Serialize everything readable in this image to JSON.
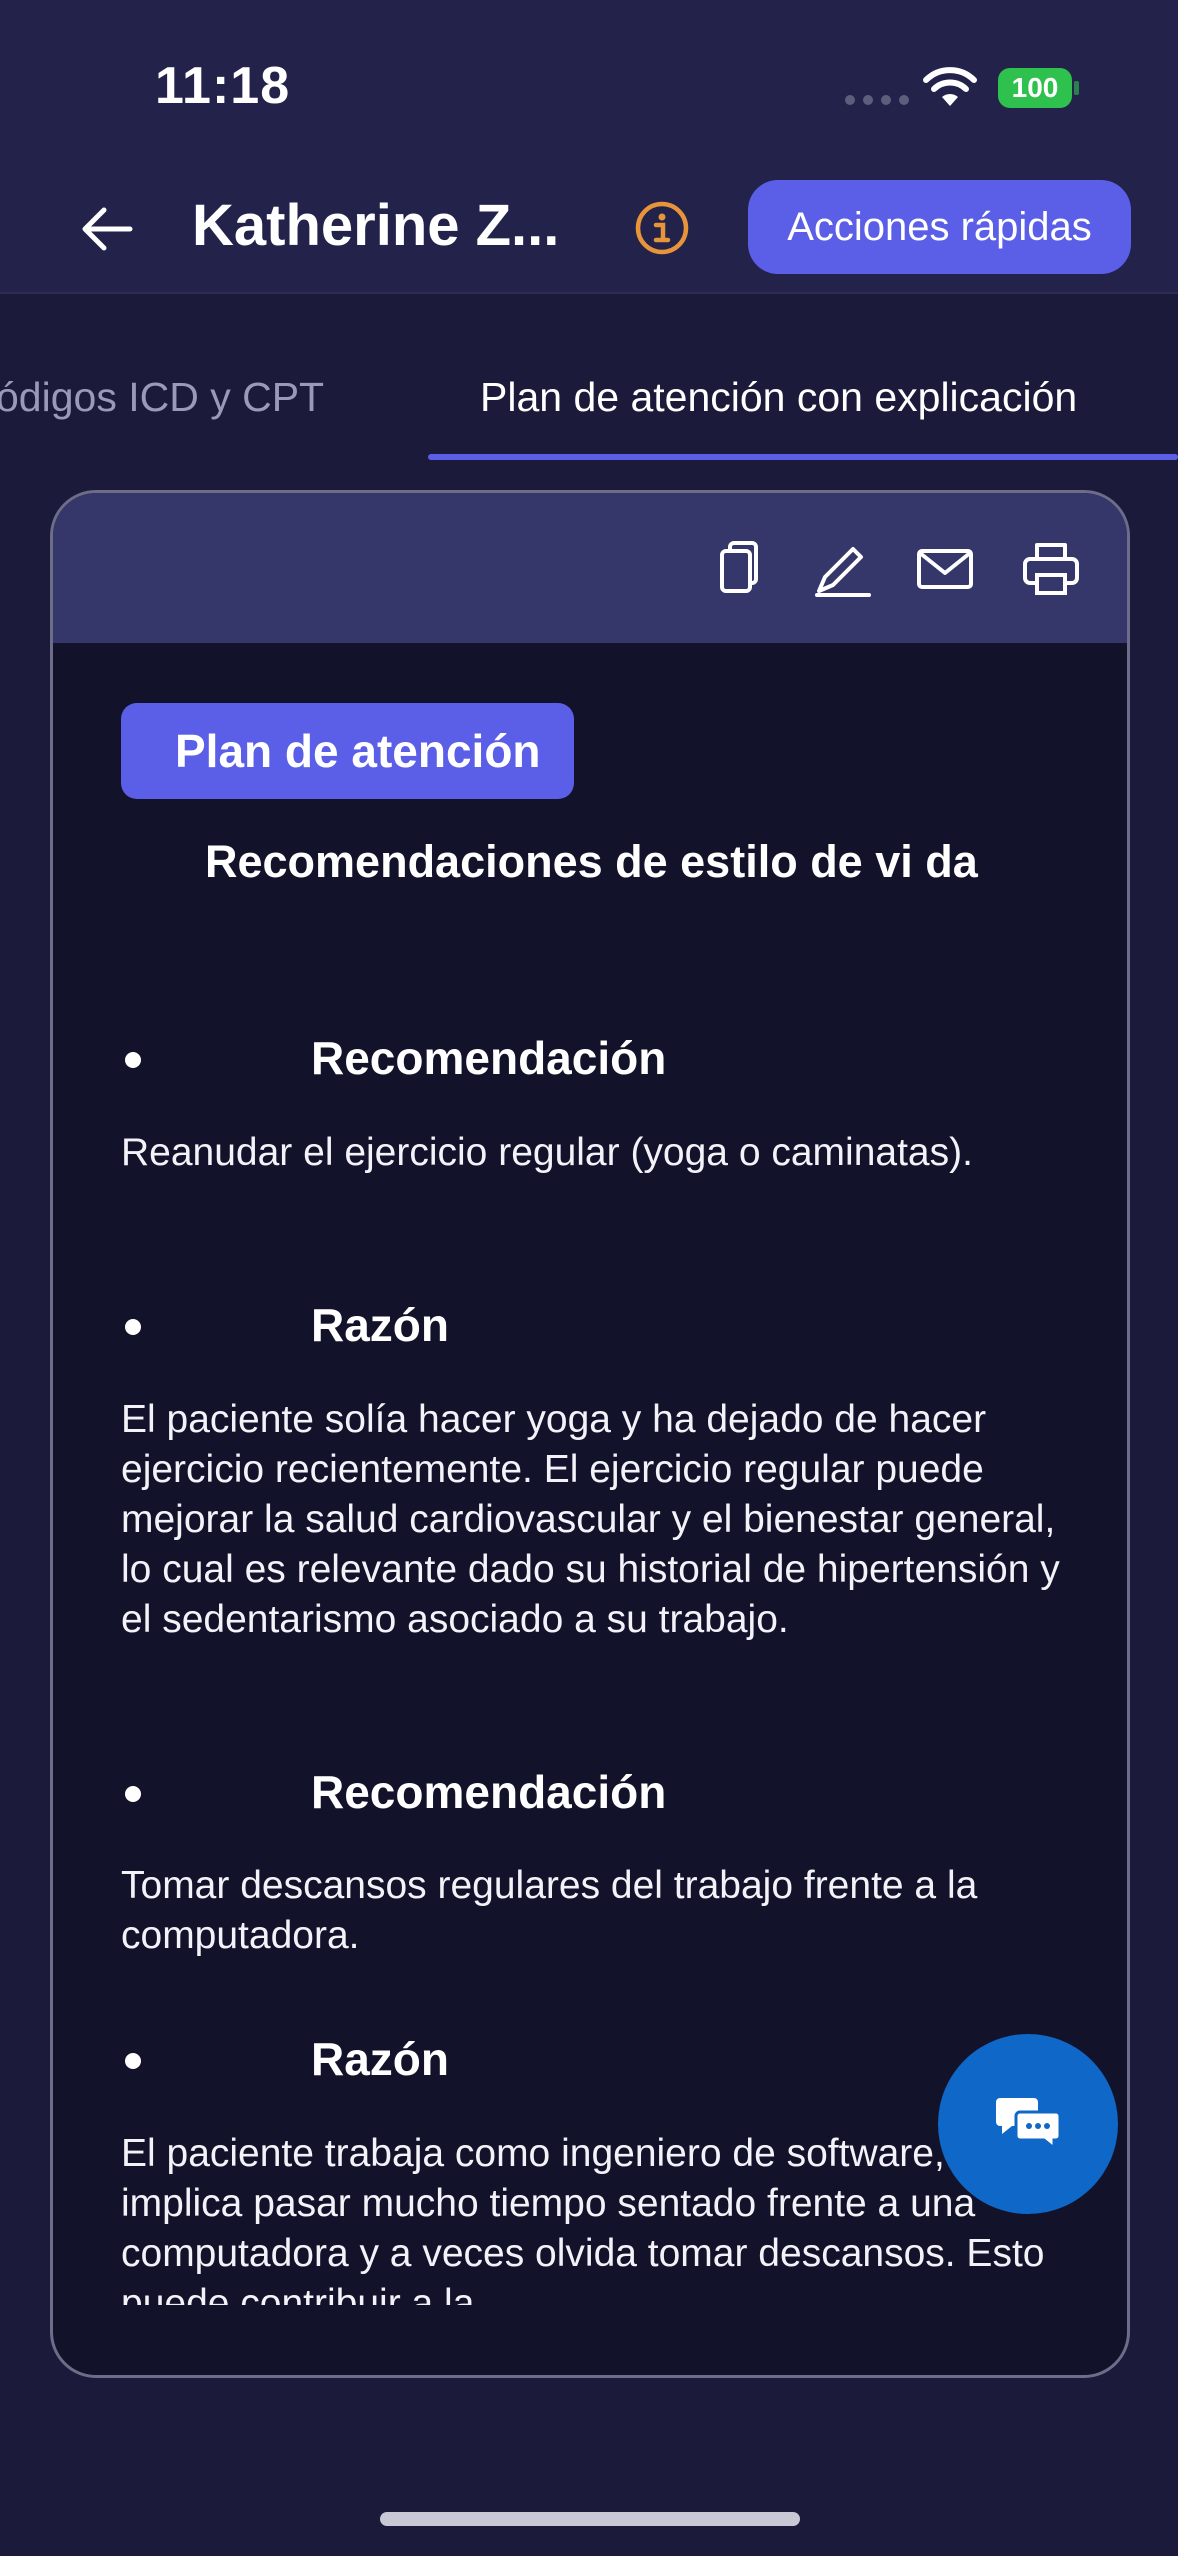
{
  "status_bar": {
    "time": "11:18",
    "battery": "100"
  },
  "header": {
    "title": "Katherine Z...",
    "quick_actions_label": "Acciones rápidas"
  },
  "tabs": [
    {
      "label": "ódigos ICD y CPT",
      "active": false
    },
    {
      "label": "Plan de atención con explicación",
      "active": true
    }
  ],
  "card": {
    "toolbar_icons": [
      "copy-icon",
      "edit-icon",
      "mail-icon",
      "print-icon"
    ],
    "plan_label": "Plan de atención",
    "section_title": "Recomendaciones de estilo de vi da",
    "items": [
      {
        "label": "Recomendación",
        "text": "Reanudar el ejercicio regular (yoga o caminatas)."
      },
      {
        "label": "Razón",
        "text": "El paciente solía hacer yoga y ha dejado de hacer ejercicio recientemente. El ejercicio regular puede mejorar la salud cardiovascular y el bienestar general, lo cual es relevante dado su historial de hipertensión y el sedentarismo asociado a su trabajo."
      },
      {
        "label": "Recomendación",
        "text": "Tomar descansos regulares del trabajo frente a la computadora."
      },
      {
        "label": "Razón",
        "text": "El paciente trabaja como ingeniero de software, lo que implica pasar mucho tiempo sentado frente a una computadora y a veces olvida tomar descansos. Esto puede contribuir a la"
      }
    ]
  },
  "colors": {
    "accent": "#5b5fe8",
    "background": "#1b1a3a",
    "card": "#12122a",
    "fab": "#0f67c7",
    "info": "#e8943a"
  }
}
